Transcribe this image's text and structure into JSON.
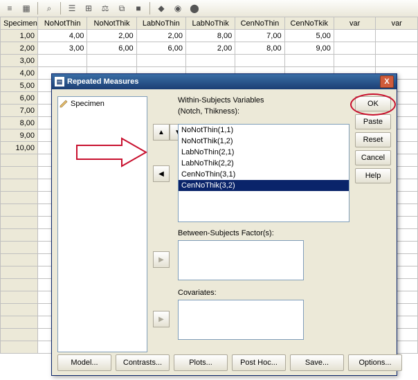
{
  "toolbar_icons": [
    "≡",
    "▦",
    "⌕",
    "☰",
    "⊞",
    "⚖",
    "⧉",
    "■",
    "◆",
    "◉",
    "⬤"
  ],
  "columns": [
    "Specimen",
    "NoNotThin",
    "NoNotThik",
    "LabNoThin",
    "LabNoThik",
    "CenNoThin",
    "CenNoTkik",
    "var",
    "var"
  ],
  "row_headers": [
    "1,00",
    "2,00",
    "3,00",
    "4,00",
    "5,00",
    "6,00",
    "7,00",
    "8,00",
    "9,00",
    "10,00",
    "",
    "",
    "",
    "",
    "",
    "",
    "",
    "",
    "",
    "",
    "",
    "",
    "",
    "",
    "",
    ""
  ],
  "grid_rows": [
    [
      "4,00",
      "2,00",
      "2,00",
      "8,00",
      "7,00",
      "5,00"
    ],
    [
      "3,00",
      "6,00",
      "6,00",
      "2,00",
      "8,00",
      "9,00"
    ]
  ],
  "dialog": {
    "title": "Repeated Measures",
    "close_glyph": "X",
    "left_list_item": "Specimen",
    "within_label": "Within-Subjects Variables",
    "within_parens": "(Notch, Thikness):",
    "within_vars": [
      "NoNotThin(1,1)",
      "NoNotThik(1,2)",
      "LabNoThin(2,1)",
      "LabNoThik(2,2)",
      "CenNoThin(3,1)",
      "CenNoThik(3,2)"
    ],
    "within_selected_index": 5,
    "between_label": "Between-Subjects Factor(s):",
    "covariates_label": "Covariates:",
    "buttons": {
      "ok": "OK",
      "paste": "Paste",
      "reset": "Reset",
      "cancel": "Cancel",
      "help": "Help",
      "model": "Model...",
      "contrasts": "Contrasts...",
      "plots": "Plots...",
      "posthoc": "Post Hoc...",
      "save": "Save...",
      "options": "Options..."
    },
    "arrow_glyphs": {
      "up": "▲",
      "down": "▼",
      "left": "◀",
      "right": "▶"
    }
  }
}
